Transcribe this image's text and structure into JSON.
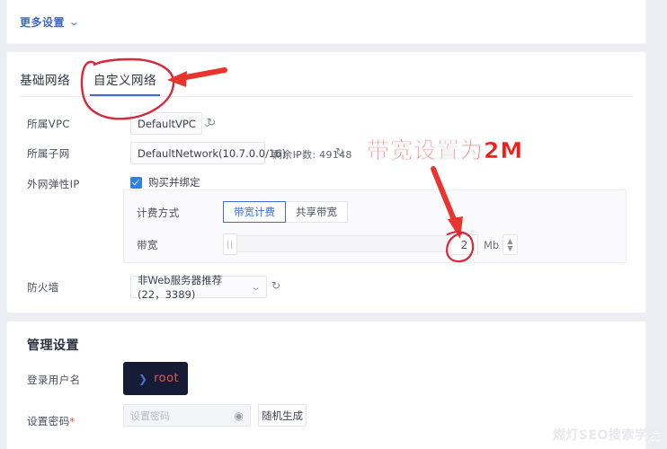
{
  "top_panel": {
    "more_settings_label": "更多设置",
    "chevron_icon": "chevron-down-icon"
  },
  "network_panel": {
    "tabs": [
      {
        "label": "基础网络",
        "active": false
      },
      {
        "label": "自定义网络",
        "active": true
      }
    ],
    "rows": {
      "vpc": {
        "label": "所属VPC",
        "value": "DefaultVPC",
        "refresh_icon": "↻"
      },
      "subnet": {
        "label": "所属子网",
        "value": "DefaultNetwork(10.7.0.0/16)",
        "note": "剩余IP数: 49148",
        "refresh_icon": "↻"
      },
      "eip": {
        "label": "外网弹性IP",
        "checkbox_label": "购买并绑定",
        "checked": true
      },
      "firewall": {
        "label": "防火墙",
        "value": "非Web服务器推荐(22，3389)",
        "refresh_icon": "↻"
      }
    },
    "bandwidth_panel": {
      "billing_label": "计费方式",
      "billing_options": [
        {
          "label": "带宽计费",
          "selected": true
        },
        {
          "label": "共享带宽",
          "selected": false
        }
      ],
      "bandwidth_label": "带宽",
      "bandwidth_value": "2",
      "bandwidth_unit": "Mb",
      "slider_handle_glyph": "||",
      "spinner_up": "▲",
      "spinner_down": "▼"
    }
  },
  "manage_panel": {
    "title": "管理设置",
    "username": {
      "label": "登录用户名",
      "prompt": "❯",
      "value": "root"
    },
    "password": {
      "label": "设置密码",
      "required_mark": "*",
      "placeholder": "设置密码",
      "value": "",
      "eye_icon": "◉",
      "generate_label": "随机生成"
    }
  },
  "annotations": {
    "bandwidth_note": "带宽设置为2M"
  },
  "watermark": {
    "text": "燃灯SEO搜索学院"
  },
  "colors": {
    "accent": "#3c6ae0",
    "link": "#4169c8",
    "annotation_red": "#f01e19",
    "checkbox_blue": "#2d7ff0",
    "terminal_bg": "#161c36",
    "terminal_user": "#e05a4e",
    "page_bg": "#eceef4"
  }
}
